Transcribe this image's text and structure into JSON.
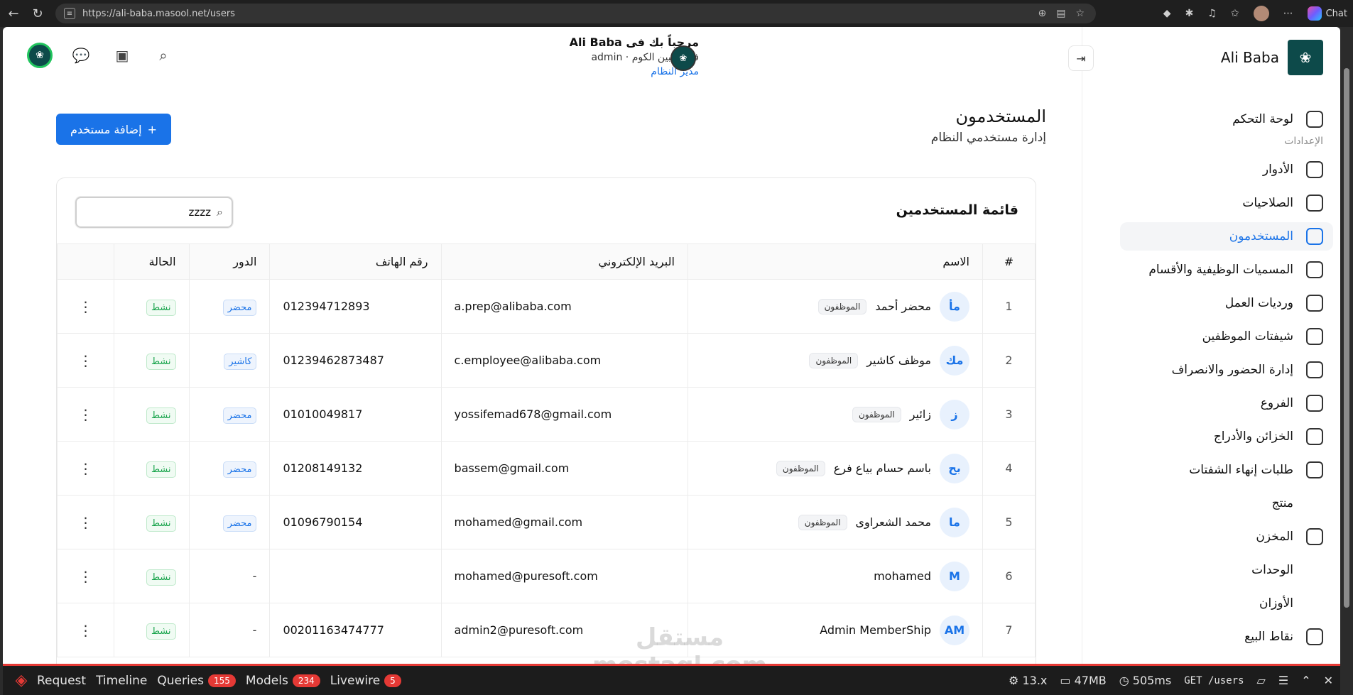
{
  "browser": {
    "url": "https://ali-baba.masool.net/users",
    "chat_label": "Chat"
  },
  "sidebar": {
    "brand": "Ali Baba",
    "items": [
      {
        "label": "لوحة التحكم",
        "icon": "grid-icon"
      },
      {
        "section": "الإعدادات"
      },
      {
        "label": "الأدوار",
        "icon": "user-shield-icon"
      },
      {
        "label": "الصلاحيات",
        "icon": "shield-check-icon"
      },
      {
        "label": "المستخدمون",
        "icon": "users-icon",
        "active": true
      },
      {
        "label": "المسميات الوظيفية والأقسام",
        "icon": "briefcase-icon"
      },
      {
        "label": "ورديات العمل",
        "icon": "calendar-icon"
      },
      {
        "label": "شيفتات الموظفين",
        "icon": "clock-icon"
      },
      {
        "label": "إدارة الحضور والانصراف",
        "icon": "calendar-check-icon"
      },
      {
        "label": "الفروع",
        "icon": "store-icon"
      },
      {
        "label": "الخزائن والأدراج",
        "icon": "safe-icon"
      },
      {
        "label": "طلبات إنهاء الشفتات",
        "icon": "request-icon"
      },
      {
        "label": "منتج",
        "icon": ""
      },
      {
        "label": "المخزن",
        "icon": "warehouse-icon"
      },
      {
        "label": "الوحدات",
        "icon": ""
      },
      {
        "label": "الأوزان",
        "icon": ""
      },
      {
        "label": "نقاط البيع",
        "icon": "pos-icon"
      }
    ]
  },
  "header": {
    "welcome_title": "مرحباً بك فى Ali Baba",
    "welcome_sub": "فرع شبين الكوم · admin",
    "welcome_role": "مدير النظام"
  },
  "page": {
    "title": "المستخدمون",
    "subtitle": "إدارة مستخدمي النظام",
    "add_button": "إضافة مستخدم"
  },
  "card": {
    "title": "قائمة المستخدمين",
    "search_value": "zzzz"
  },
  "table": {
    "columns": [
      "#",
      "الاسم",
      "البريد الإلكتروني",
      "رقم الهاتف",
      "الدور",
      "الحالة",
      ""
    ],
    "rows": [
      {
        "idx": "1",
        "initials": "مأ",
        "name": "محضر أحمد",
        "dept": "الموظفون",
        "email": "a.prep@alibaba.com",
        "phone": "012394712893",
        "role": "محضر",
        "status": "نشط"
      },
      {
        "idx": "2",
        "initials": "مك",
        "name": "موظف كاشير",
        "dept": "الموظفون",
        "email": "c.employee@alibaba.com",
        "phone": "01239462873487",
        "role": "كاشير",
        "status": "نشط"
      },
      {
        "idx": "3",
        "initials": "ز",
        "name": "زائير",
        "dept": "الموظفون",
        "email": "yossifemad678@gmail.com",
        "phone": "01010049817",
        "role": "محضر",
        "status": "نشط"
      },
      {
        "idx": "4",
        "initials": "بح",
        "name": "باسم حسام بياع فرع",
        "dept": "الموظفون",
        "email": "bassem@gmail.com",
        "phone": "01208149132",
        "role": "محضر",
        "status": "نشط"
      },
      {
        "idx": "5",
        "initials": "ما",
        "name": "محمد الشعراوى",
        "dept": "الموظفون",
        "email": "mohamed@gmail.com",
        "phone": "01096790154",
        "role": "محضر",
        "status": "نشط"
      },
      {
        "idx": "6",
        "initials": "M",
        "name": "mohamed",
        "dept": "",
        "email": "mohamed@puresoft.com",
        "phone": "",
        "role": "-",
        "status": "نشط"
      },
      {
        "idx": "7",
        "initials": "AM",
        "name": "Admin MemberShip",
        "dept": "",
        "email": "admin2@puresoft.com",
        "phone": "00201163474777",
        "role": "-",
        "status": "نشط"
      }
    ]
  },
  "debugbar": {
    "items": [
      {
        "label": "Request"
      },
      {
        "label": "Timeline"
      },
      {
        "label": "Queries",
        "count": "155"
      },
      {
        "label": "Models",
        "count": "234"
      },
      {
        "label": "Livewire",
        "count": "5"
      }
    ],
    "version": "13.x",
    "memory": "47MB",
    "time": "505ms",
    "route": "GET /users"
  },
  "watermark": {
    "line1": "مستقل",
    "line2": "mostaql.com"
  },
  "colors": {
    "accent": "#1a73e8",
    "success": "#16a34a",
    "debug_red": "#e53935",
    "brand_dark": "#0d4a4a"
  }
}
